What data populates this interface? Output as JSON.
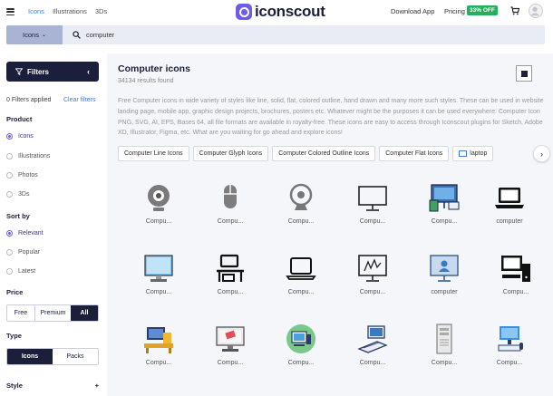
{
  "nav": {
    "links": [
      "Icons",
      "Illustrations",
      "3Ds"
    ],
    "brand": "iconscout",
    "download": "Download App",
    "pricing": "Pricing",
    "offer": "33% OFF"
  },
  "search": {
    "type": "Icons",
    "query": "computer"
  },
  "sidebar": {
    "filters_label": "Filters",
    "applied": "0 Filters applied",
    "clear": "Clear filters",
    "product": {
      "title": "Product",
      "options": [
        "Icons",
        "Illustrations",
        "Photos",
        "3Ds"
      ],
      "selected": "Icons"
    },
    "sort": {
      "title": "Sort by",
      "options": [
        "Relevant",
        "Popular",
        "Latest"
      ],
      "selected": "Relevant"
    },
    "price": {
      "title": "Price",
      "options": [
        "Free",
        "Premium",
        "All"
      ],
      "selected": "All"
    },
    "type": {
      "title": "Type",
      "options": [
        "Icons",
        "Packs"
      ],
      "selected": "Icons"
    },
    "style": {
      "title": "Style",
      "toggle": "+"
    }
  },
  "main": {
    "title": "Computer icons",
    "count": "34134 results found",
    "description": "Free Computer icons in wide variety of styles like line, solid, flat, colored outline, hand drawn and many more such styles. These can be used in website landing page, mobile app, graphic design projects, brochures, posters etc. Whatever might be the purposes it can be used everywhere: Computer Icon PNG, SVG, AI, EPS, Bases 64, all file formats are available in royalty-free. These icons are easy to access through Iconscout plugins for Sketch, Adobe XD, Illustrator, Figma, etc. What are you waiting for go ahead and explore icons!",
    "chips": [
      "Computer Line Icons",
      "Computer Glyph Icons",
      "Computer Colored Outline Icons",
      "Computer Flat Icons",
      "laptop"
    ],
    "icons": [
      {
        "label": "Compu...",
        "icon": "webcam-gray-icon"
      },
      {
        "label": "Compu...",
        "icon": "mouse-gray-icon"
      },
      {
        "label": "Compu...",
        "icon": "webcam-outline-icon"
      },
      {
        "label": "Compu...",
        "icon": "monitor-line-icon"
      },
      {
        "label": "Compu...",
        "icon": "devices-flat-icon"
      },
      {
        "label": "computer",
        "icon": "laptop-solid-icon"
      },
      {
        "label": "Compu...",
        "icon": "monitor-blue-icon"
      },
      {
        "label": "Compu...",
        "icon": "desk-computer-icon"
      },
      {
        "label": "Compu...",
        "icon": "laptop-line-icon"
      },
      {
        "label": "Compu...",
        "icon": "monitor-circuit-icon"
      },
      {
        "label": "computer",
        "icon": "monitor-user-icon"
      },
      {
        "label": "Compu...",
        "icon": "desktop-tower-icon"
      },
      {
        "label": "Compu...",
        "icon": "workstation-flat-icon"
      },
      {
        "label": "Compu...",
        "icon": "monitor-red-icon"
      },
      {
        "label": "Compu...",
        "icon": "computer-green-circle-icon"
      },
      {
        "label": "Compu...",
        "icon": "keyboard-monitor-icon"
      },
      {
        "label": "Compu...",
        "icon": "tower-case-icon"
      },
      {
        "label": "Compu...",
        "icon": "desktop-blue-icon"
      }
    ]
  },
  "colors": {
    "navy": "#1b1f3b",
    "brand": "#6e5ce8",
    "accent_link": "#3d7ee5",
    "offer_green": "#20b15a",
    "search_bg": "#e9ebf5",
    "search_type_bg": "#a9b3d4"
  }
}
